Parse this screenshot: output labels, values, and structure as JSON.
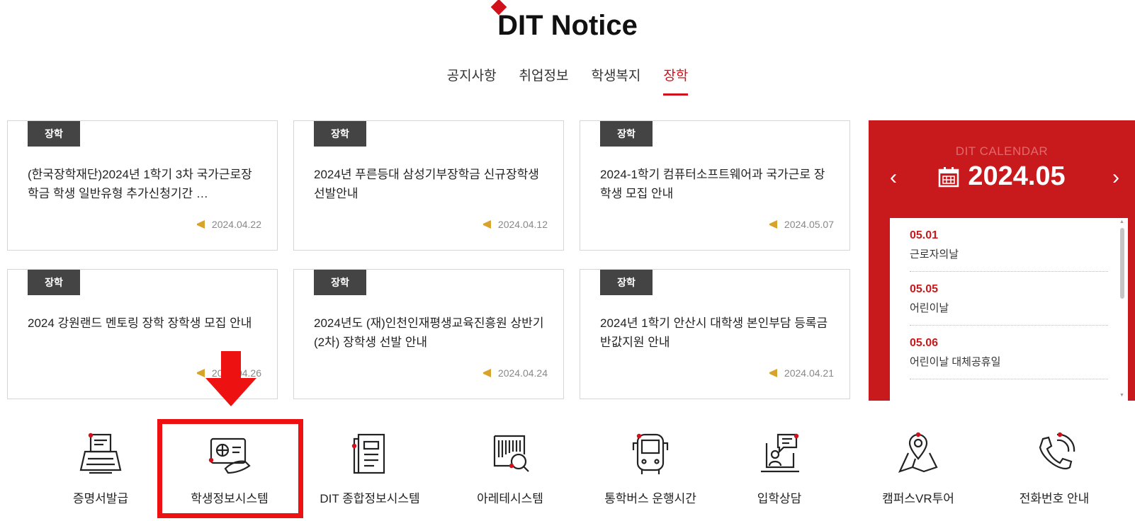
{
  "header": {
    "title": "DIT Notice"
  },
  "tabs": [
    {
      "label": "공지사항"
    },
    {
      "label": "취업정보"
    },
    {
      "label": "학생복지"
    },
    {
      "label": "장학",
      "active": true
    }
  ],
  "cards": [
    {
      "badge": "장학",
      "title": "(한국장학재단)2024년 1학기 3차 국가근로장학금 학생 일반유형 추가신청기간 …",
      "date": "2024.04.22"
    },
    {
      "badge": "장학",
      "title": "2024년 푸른등대 삼성기부장학금 신규장학생 선발안내",
      "date": "2024.04.12"
    },
    {
      "badge": "장학",
      "title": "2024-1학기 컴퓨터소프트웨어과 국가근로 장학생 모집 안내",
      "date": "2024.05.07"
    },
    {
      "badge": "장학",
      "title": "2024 강원랜드 멘토링 장학 장학생 모집 안내",
      "date": "2024.04.26"
    },
    {
      "badge": "장학",
      "title": "2024년도 (재)인천인재평생교육진흥원 상반기(2차) 장학생 선발 안내",
      "date": "2024.04.24"
    },
    {
      "badge": "장학",
      "title": "2024년 1학기 안산시 대학생 본인부담 등록금 반값지원 안내",
      "date": "2024.04.21"
    }
  ],
  "calendar": {
    "label": "DIT CALENDAR",
    "month": "2024.05",
    "prev": "‹",
    "next": "›",
    "events": [
      {
        "date": "05.01",
        "name": "근로자의날"
      },
      {
        "date": "05.05",
        "name": "어린이날"
      },
      {
        "date": "05.06",
        "name": "어린이날 대체공휴일"
      }
    ]
  },
  "quick_links": [
    {
      "label": "증명서발급",
      "icon": "typewriter-icon"
    },
    {
      "label": "학생정보시스템",
      "icon": "id-card-icon"
    },
    {
      "label": "DIT 종합정보시스템",
      "icon": "document-icon"
    },
    {
      "label": "아레테시스템",
      "icon": "barcode-search-icon"
    },
    {
      "label": "통학버스 운행시간",
      "icon": "bus-icon"
    },
    {
      "label": "입학상담",
      "icon": "consultation-icon"
    },
    {
      "label": "캠퍼스VR투어",
      "icon": "map-pin-icon"
    },
    {
      "label": "전화번호 안내",
      "icon": "phone-icon"
    }
  ],
  "colors": {
    "accent": "#d0111b",
    "calendar_bg": "#c8191c",
    "annotation": "#ee1111"
  }
}
